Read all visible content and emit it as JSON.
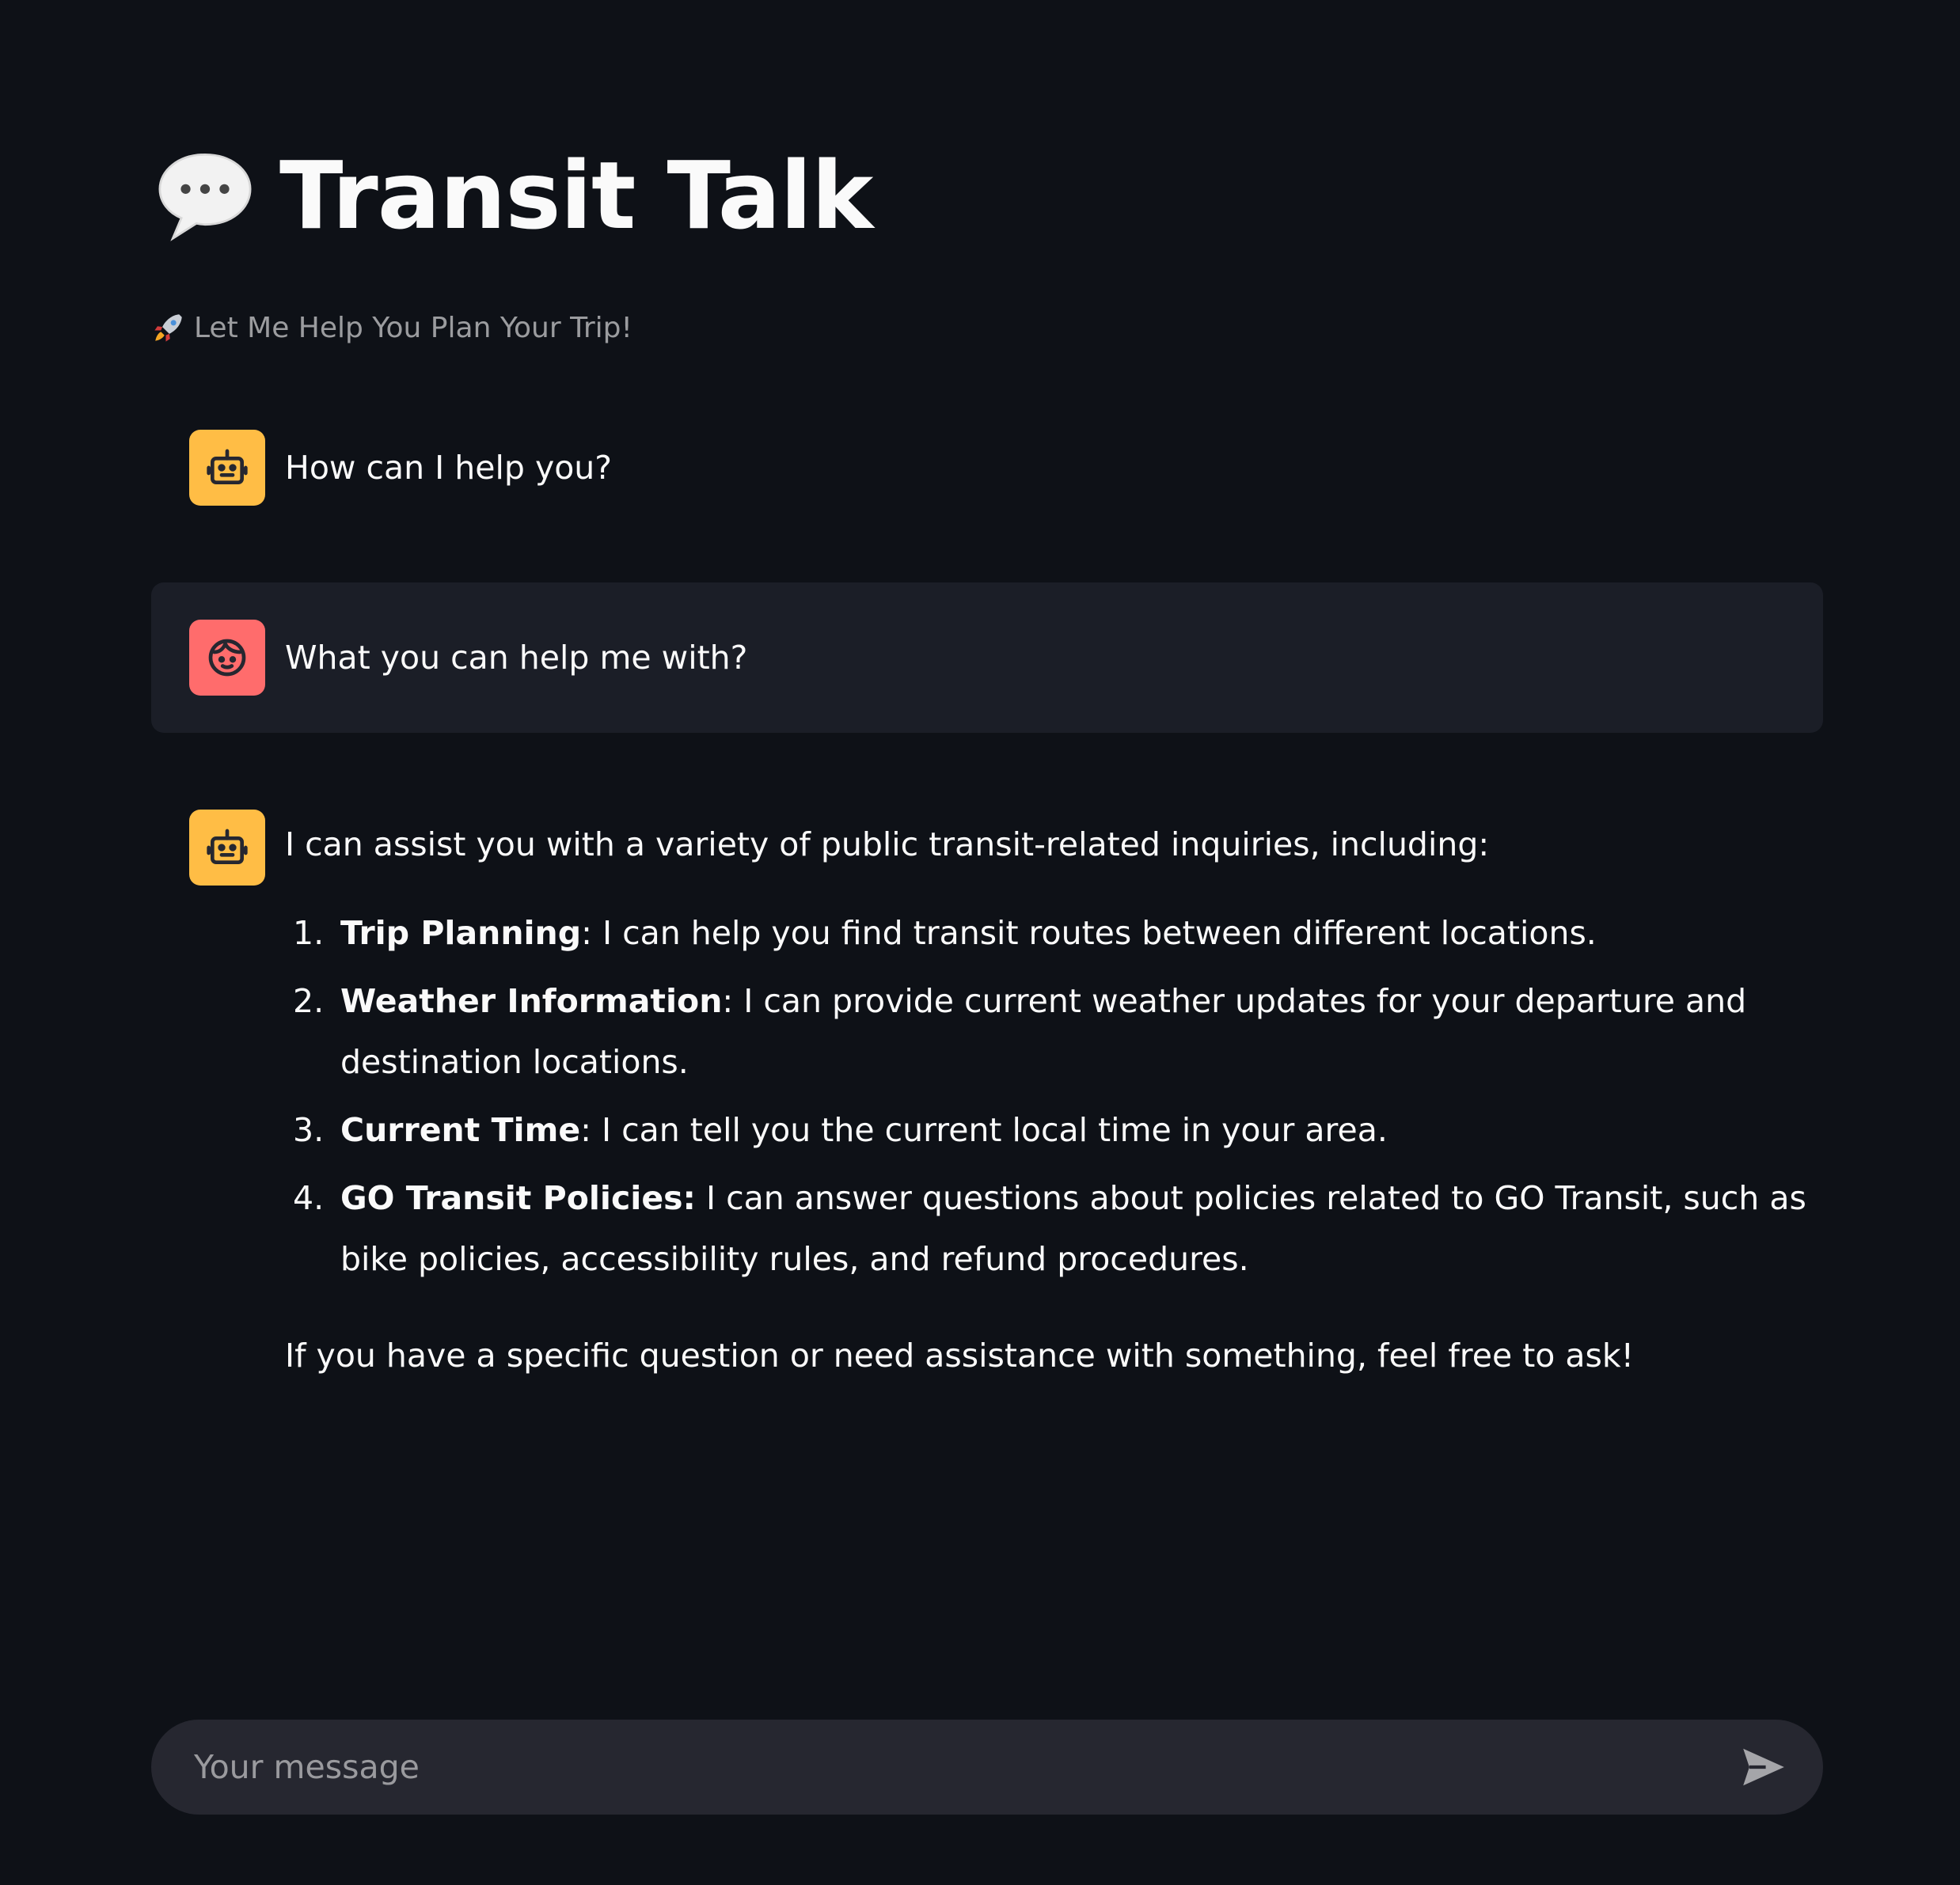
{
  "header": {
    "title": "Transit Talk",
    "title_icon": "speech-balloon-icon",
    "subtitle": "Let Me Help You Plan Your Trip!",
    "subtitle_icon": "rocket-icon"
  },
  "messages": [
    {
      "role": "assistant",
      "avatar_icon": "robot-face-icon",
      "text": "How can I help you?"
    },
    {
      "role": "user",
      "avatar_icon": "user-face-icon",
      "text": "What you can help me with?"
    },
    {
      "role": "assistant",
      "avatar_icon": "robot-face-icon",
      "intro": "I can assist you with a variety of public transit-related inquiries, including:",
      "items": [
        {
          "number": "1.",
          "title": "Trip Planning",
          "text": ": I can help you find transit routes between different locations."
        },
        {
          "number": "2.",
          "title": "Weather Information",
          "text": ": I can provide current weather updates for your departure and destination locations."
        },
        {
          "number": "3.",
          "title": "Current Time",
          "text": ": I can tell you the current local time in your area."
        },
        {
          "number": "4.",
          "title": "GO Transit Policies:",
          "text": " I can answer questions about policies related to GO Transit, such as bike policies, accessibility rules, and refund procedures."
        }
      ],
      "closing": "If you have a specific question or need assistance with something, feel free to ask!"
    }
  ],
  "chat_input": {
    "placeholder": "Your message",
    "value": "",
    "send_icon": "send-arrow-icon"
  },
  "colors": {
    "background": "#0e1117",
    "user_message_bg": "#1b1e27",
    "assistant_avatar": "#ffbd45",
    "user_avatar": "#ff6c6c",
    "input_bg": "#262730",
    "text": "#fafafa"
  }
}
